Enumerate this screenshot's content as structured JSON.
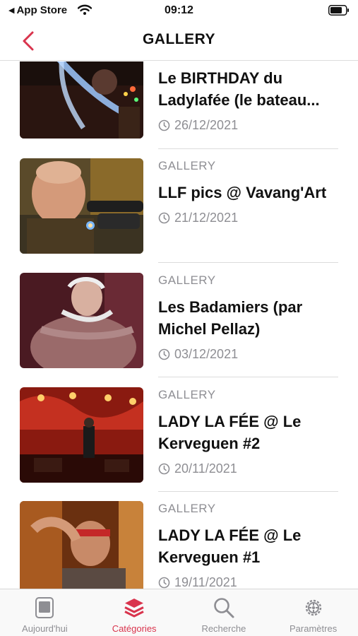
{
  "status_bar": {
    "back_app": "App Store",
    "time": "09:12"
  },
  "nav": {
    "title": "GALLERY"
  },
  "items": [
    {
      "category": "",
      "title": "Le BIRTHDAY du Ladylafée (le bateau...",
      "date": "26/12/2021"
    },
    {
      "category": "GALLERY",
      "title": "LLF pics @ Vavang'Art",
      "date": "21/12/2021"
    },
    {
      "category": "GALLERY",
      "title": "Les Badamiers (par Michel Pellaz)",
      "date": "03/12/2021"
    },
    {
      "category": "GALLERY",
      "title": "LADY LA FÉE @ Le Kerveguen #2",
      "date": "20/11/2021"
    },
    {
      "category": "GALLERY",
      "title": "LADY LA FÉE @ Le Kerveguen #1",
      "date": "19/11/2021"
    }
  ],
  "tabs": [
    {
      "label": "Aujourd'hui",
      "icon": "today-icon"
    },
    {
      "label": "Catégories",
      "icon": "layers-icon"
    },
    {
      "label": "Recherche",
      "icon": "search-icon"
    },
    {
      "label": "Paramètres",
      "icon": "gear-icon"
    }
  ],
  "colors": {
    "accent": "#d9344d",
    "secondary_text": "#8e8e93"
  }
}
